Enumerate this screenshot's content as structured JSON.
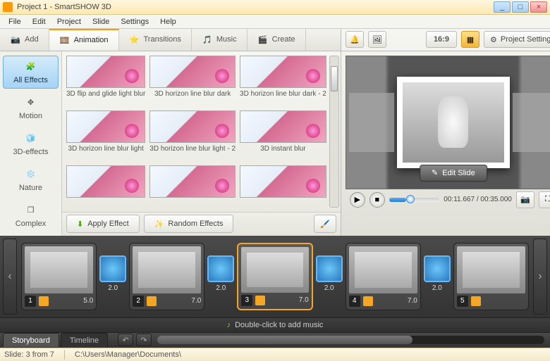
{
  "window": {
    "title": "Project 1 - SmartSHOW 3D",
    "minimize": "_",
    "maximize": "□",
    "close": "×"
  },
  "menu": [
    "File",
    "Edit",
    "Project",
    "Slide",
    "Settings",
    "Help"
  ],
  "mainTabs": {
    "add": "Add",
    "animation": "Animation",
    "transitions": "Transitions",
    "music": "Music",
    "create": "Create"
  },
  "rightTop": {
    "ratio": "16:9",
    "projectSettings": "Project Settings"
  },
  "categories": {
    "allEffects": "All Effects",
    "motion": "Motion",
    "effects3d": "3D-effects",
    "nature": "Nature",
    "complex": "Complex"
  },
  "effects": [
    "3D flip and glide light blur",
    "3D horizon line blur dark",
    "3D horizon line blur dark - 2",
    "3D horizon line blur light",
    "3D horizon line blur light - 2",
    "3D instant blur",
    "",
    "",
    ""
  ],
  "fxButtons": {
    "apply": "Apply Effect",
    "random": "Random Effects"
  },
  "preview": {
    "editSlide": "Edit Slide",
    "time": "00:11.667 / 00:35.000"
  },
  "storyboard": {
    "slides": [
      {
        "num": "1",
        "dur": "5.0"
      },
      {
        "num": "2",
        "dur": "7.0"
      },
      {
        "num": "3",
        "dur": "7.0"
      },
      {
        "num": "4",
        "dur": "7.0"
      },
      {
        "num": "5",
        "dur": ""
      }
    ],
    "transDur": "2.0",
    "musicHint": "Double-click to add music"
  },
  "bottomTabs": {
    "storyboard": "Storyboard",
    "timeline": "Timeline"
  },
  "status": {
    "slide": "Slide: 3 from 7",
    "path": "C:\\Users\\Manager\\Documents\\"
  }
}
